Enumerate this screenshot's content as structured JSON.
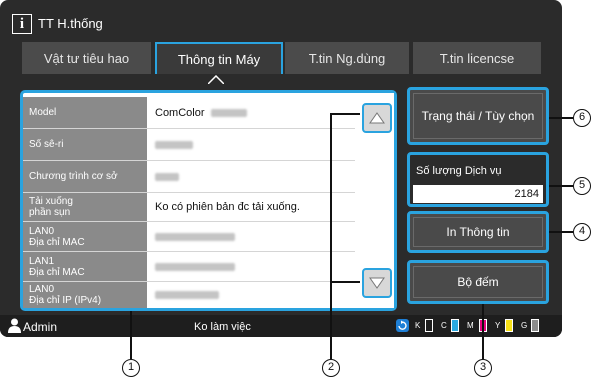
{
  "header": {
    "title": "TT H.thống"
  },
  "tabs": [
    {
      "label": "Vật tư tiêu hao",
      "active": false
    },
    {
      "label": "Thông tin Máy",
      "active": true
    },
    {
      "label": "T.tin Ng.dùng",
      "active": false
    },
    {
      "label": "T.tin licencse",
      "active": false
    }
  ],
  "info_rows": [
    {
      "label": "Model",
      "value": "ComColor"
    },
    {
      "label": "Số sê-ri",
      "value": ""
    },
    {
      "label": "Chương trình cơ sở",
      "value": ""
    },
    {
      "label": "Tải xuống\nphần sụn",
      "value": "Ko có phiên bản đc tải xuống."
    },
    {
      "label": "LAN0\nĐịa chỉ MAC",
      "value": ""
    },
    {
      "label": "LAN1\nĐịa chỉ MAC",
      "value": ""
    },
    {
      "label": "LAN0\nĐịa chỉ IP (IPv4)",
      "value": ""
    }
  ],
  "buttons": {
    "status_options": "Trạng thái / Tùy chọn",
    "print_info": "In Thông tin",
    "counter": "Bộ đếm"
  },
  "service_count": {
    "label": "Số lượng Dịch vụ",
    "value": "2184"
  },
  "status_bar": {
    "user": "Admin",
    "status": "Ko làm việc",
    "inks": [
      {
        "label": "K",
        "color": "#ffffff"
      },
      {
        "label": "C",
        "color": "#29a8e0"
      },
      {
        "label": "M",
        "color": "#e6007e"
      },
      {
        "label": "Y",
        "color": "#f7e017"
      },
      {
        "label": "G",
        "color": "#8c8c8c"
      }
    ]
  },
  "callouts": [
    "1",
    "2",
    "3",
    "4",
    "5",
    "6"
  ],
  "colors": {
    "accent": "#2aa3df",
    "panel": "#2b2b2b",
    "label_bg": "#8a8a8a"
  }
}
